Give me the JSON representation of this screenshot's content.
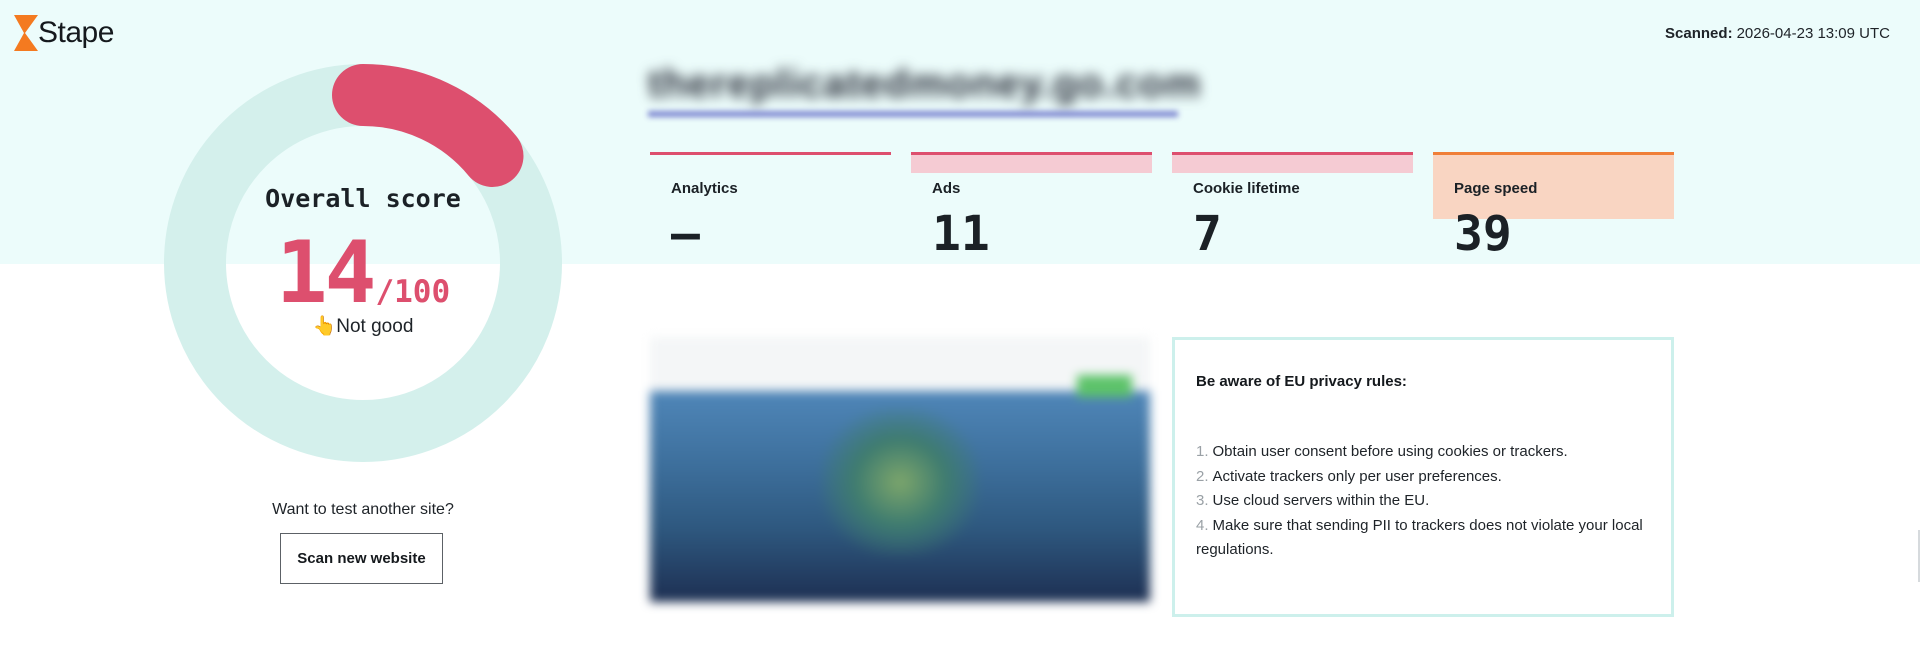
{
  "brand": {
    "name": "Stape",
    "accent": "#f47a20",
    "logo_icon": "stape-logo-mark"
  },
  "header": {
    "scanned_label": "Scanned:",
    "scanned_value": "2026-04-23 13:09 UTC"
  },
  "score": {
    "title": "Overall score",
    "value": "14",
    "max": "/100",
    "status": "👆Not good",
    "fraction": 0.14,
    "ring_color": "#dd4f6e",
    "track_color": "#d4f0ec"
  },
  "retest": {
    "label": "Want to test another site?",
    "button": "Scan new website"
  },
  "site": {
    "url": "thereplicatedmoney.go.com"
  },
  "metrics": [
    {
      "label": "Analytics",
      "value": "–",
      "status": "bad"
    },
    {
      "label": "Ads",
      "value": "11",
      "status": "bad"
    },
    {
      "label": "Cookie lifetime",
      "value": "7",
      "status": "bad"
    },
    {
      "label": "Page speed",
      "value": "39",
      "status": "warning"
    }
  ],
  "privacy": {
    "title": "Be aware of EU privacy rules:",
    "items": [
      {
        "num": "1.",
        "text": "Obtain user consent before using cookies or trackers."
      },
      {
        "num": "2.",
        "text": "Activate trackers only per user preferences."
      },
      {
        "num": "3.",
        "text": "Use cloud servers within the EU."
      },
      {
        "num": "4.",
        "text": "Make sure that sending PII to trackers does not violate your local regulations."
      }
    ]
  }
}
